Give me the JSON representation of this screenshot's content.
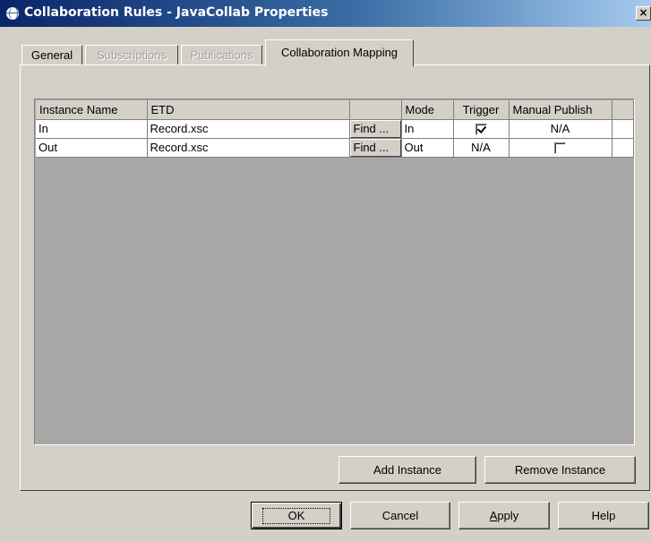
{
  "window": {
    "title": "Collaboration Rules - JavaCollab Properties",
    "close": "×"
  },
  "tabs": [
    {
      "label": "General",
      "state": "normal"
    },
    {
      "label": "Subscriptions",
      "state": "disabled"
    },
    {
      "label": "Publications",
      "state": "disabled"
    },
    {
      "label": "Collaboration Mapping",
      "state": "active"
    }
  ],
  "table": {
    "columns": [
      "Instance Name",
      "ETD",
      "",
      "Mode",
      "Trigger",
      "Manual Publish",
      ""
    ],
    "find_label": "Find ...",
    "rows": [
      {
        "instance": "In",
        "etd": "Record.xsc",
        "mode": "In",
        "trigger": "checked",
        "manual_publish": "N/A"
      },
      {
        "instance": "Out",
        "etd": "Record.xsc",
        "mode": "Out",
        "trigger": "N/A",
        "manual_publish": "unchecked"
      }
    ]
  },
  "buttons": {
    "add_instance": "Add Instance",
    "remove_instance": "Remove Instance",
    "ok": "OK",
    "cancel": "Cancel",
    "apply_prefix": "",
    "apply_mnemonic": "A",
    "apply_rest": "pply",
    "help": "Help"
  }
}
